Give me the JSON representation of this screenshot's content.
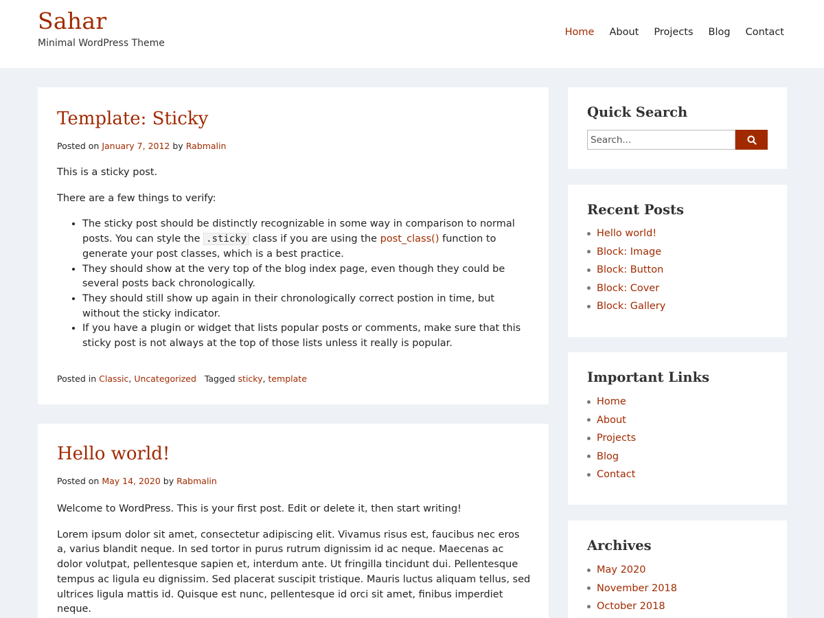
{
  "site": {
    "title": "Sahar",
    "tagline": "Minimal WordPress Theme"
  },
  "nav": {
    "items": [
      {
        "label": "Home",
        "active": true
      },
      {
        "label": "About"
      },
      {
        "label": "Projects"
      },
      {
        "label": "Blog"
      },
      {
        "label": "Contact"
      }
    ]
  },
  "posts": [
    {
      "title": "Template: Sticky",
      "meta": {
        "posted_on": "Posted on",
        "date": "January 7, 2012",
        "by": "by",
        "author": "Rabmalin"
      },
      "p1": "This is a sticky post.",
      "p2": "There are a few things to verify:",
      "li1_a": "The sticky post should be distinctly recognizable in some way in comparison to normal posts. You can style the",
      "li1_code": ".sticky",
      "li1_b": "class if you are using the",
      "li1_link": "post_class()",
      "li1_c": "function to generate your post classes, which is a best practice.",
      "li2": "They should show at the very top of the blog index page, even though they could be several posts back chronologically.",
      "li3": "They should still show up again in their chronologically correct postion in time, but without the sticky indicator.",
      "li4": "If you have a plugin or widget that lists popular posts or comments, make sure that this sticky post is not always at the top of those lists unless it really is popular.",
      "footer": {
        "posted_in": "Posted in",
        "cat1": "Classic",
        "cat2": "Uncategorized",
        "tagged": "Tagged",
        "tag1": "sticky",
        "tag2": "template"
      }
    },
    {
      "title": "Hello world!",
      "meta": {
        "posted_on": "Posted on",
        "date": "May 14, 2020",
        "by": "by",
        "author": "Rabmalin"
      },
      "p1": "Welcome to WordPress. This is your first post. Edit or delete it, then start writing!",
      "p2": "Lorem ipsum dolor sit amet, consectetur adipiscing elit. Vivamus risus est, faucibus nec eros a, varius blandit neque. In sed tortor in purus rutrum dignissim id ac neque. Maecenas ac dolor volutpat, pellentesque sapien et, interdum ante. Ut fringilla tincidunt dui. Pellentesque tempus ac ligula eu dignissim. Sed placerat suscipit tristique. Mauris luctus aliquam tellus, sed ultrices ligula mattis id. Quisque est nunc, pellentesque id orci sit amet, finibus imperdiet neque."
    }
  ],
  "sidebar": {
    "search": {
      "title": "Quick Search",
      "placeholder": "Search..."
    },
    "recent": {
      "title": "Recent Posts",
      "items": [
        "Hello world!",
        "Block: Image",
        "Block: Button",
        "Block: Cover",
        "Block: Gallery"
      ]
    },
    "links": {
      "title": "Important Links",
      "items": [
        "Home",
        "About",
        "Projects",
        "Blog",
        "Contact"
      ]
    },
    "archives": {
      "title": "Archives",
      "items": [
        "May 2020",
        "November 2018",
        "October 2018"
      ]
    }
  },
  "colors": {
    "accent": "#a12a00",
    "background": "#eef1f5"
  }
}
